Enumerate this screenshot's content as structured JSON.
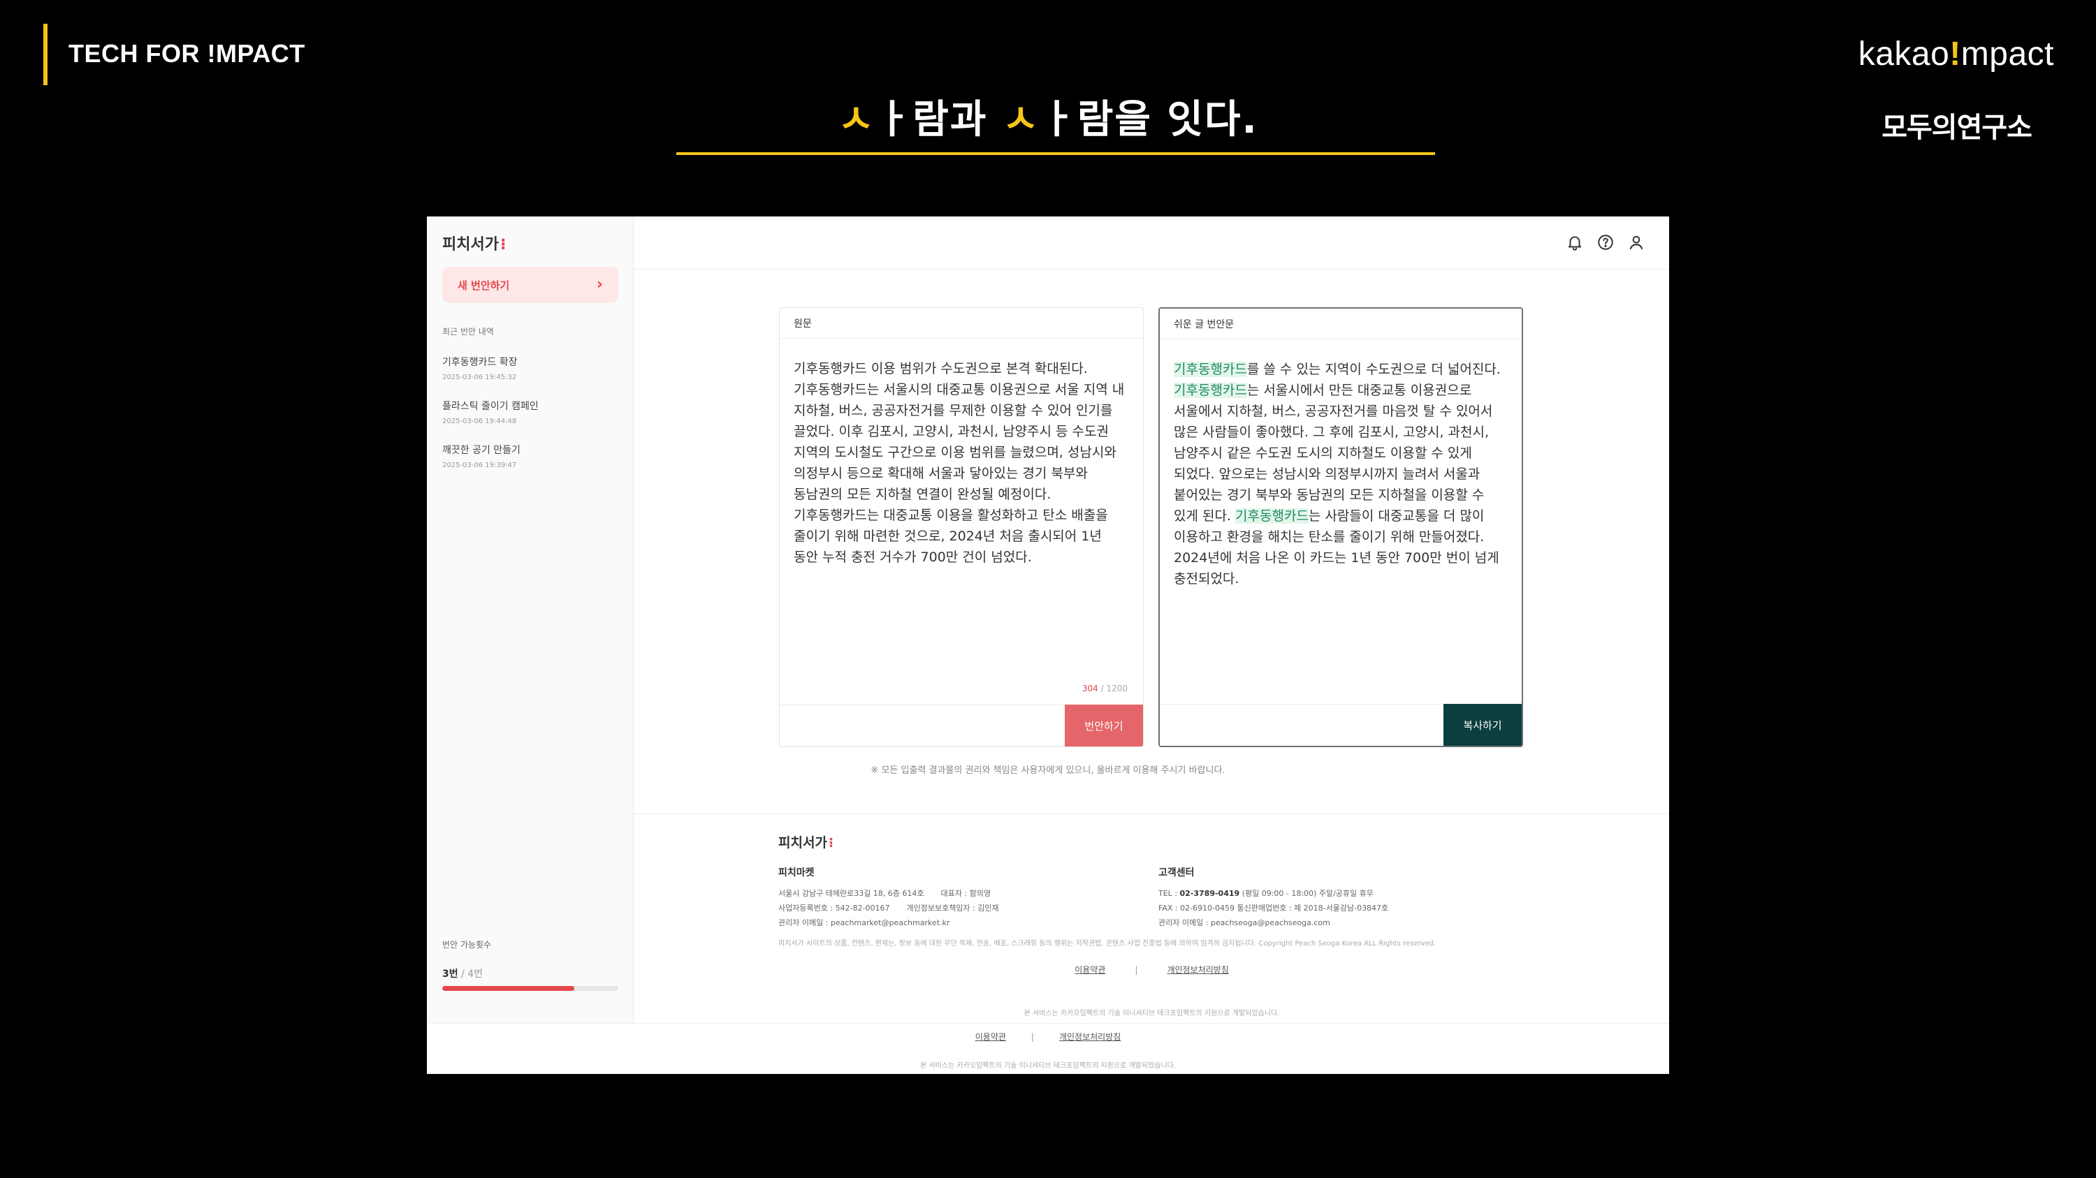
{
  "slide": {
    "brand": "TECH FOR !MPACT",
    "title": {
      "p1": "ㅅ",
      "p2": "ㅏ람과 ",
      "p3": "ㅅ",
      "p4": "ㅏ람을 잇다."
    },
    "kakao_logo": {
      "a": "kakao",
      "b": "!",
      "c": "mpact"
    },
    "lab_logo": "모두의연구소",
    "accent_color": "#f5c518"
  },
  "app": {
    "brand": "피치서가",
    "sidebar": {
      "new_button": "새 번안하기",
      "recent_header": "최근 번안 내역",
      "history": [
        {
          "title": "기후동행카드 확장",
          "time": "2025-03-06 19:45:32"
        },
        {
          "title": "플라스틱 줄이기 캠페인",
          "time": "2025-03-06 19:44:48"
        },
        {
          "title": "깨끗한 공기 만들기",
          "time": "2025-03-06 19:39:47"
        }
      ],
      "quota_label": "번안 가능횟수",
      "quota_used": "3번",
      "quota_total": " / 4번",
      "quota_fraction": 0.75
    },
    "topbar_icons": [
      "bell-icon",
      "help-icon",
      "user-icon"
    ],
    "source_panel": {
      "header": "원문",
      "text": "기후동행카드 이용 범위가 수도권으로 본격 확대된다. 기후동행카드는 서울시의 대중교통 이용권으로 서울 지역 내 지하철, 버스, 공공자전거를 무제한 이용할 수 있어 인기를 끌었다. 이후 김포시, 고양시, 과천시, 남양주시 등 수도권 지역의 도시철도 구간으로 이용 범위를 늘렸으며, 성남시와 의정부시 등으로 확대해 서울과 닿아있는 경기 북부와 동남권의 모든 지하철 연결이 완성될 예정이다. 기후동행카드는 대중교통 이용을 활성화하고 탄소 배출을 줄이기 위해 마련한 것으로, 2024년 처음 출시되어 1년 동안 누적 충전 거수가 700만 건이 넘었다.",
      "count_current": "304",
      "count_max": " / 1200",
      "button": "번안하기"
    },
    "easy_panel": {
      "header": "쉬운 글 번안문",
      "term": "기후동행카드",
      "seg1": "를 쓸 수 있는 지역이 수도권으로 더 넓어진다. ",
      "seg2": "는 서울시에서 만든 대중교통 이용권으로 서울에서 지하철, 버스, 공공자전거를 마음껏 탈 수 있어서 많은 사람들이 좋아했다. 그 후에 김포시, 고양시, 과천시, 남양주시 같은 수도권 도시의 지하철도 이용할 수 있게 되었다. 앞으로는 성남시와 의정부시까지 늘려서 서울과 붙어있는 경기 북부와 동남권의 모든 지하철을 이용할 수 있게 된다. ",
      "seg3": "는 사람들이 대중교통을 더 많이 이용하고 환경을 해치는 탄소를 줄이기 위해 만들어졌다. 2024년에 처음 나온 이 카드는 1년 동안 700만 번이 넘게 충전되었다.",
      "button": "복사하기",
      "highlight_color": "#1f8a63"
    },
    "disclaimer": "※ 모든 입출력 결과물의 권리와 책임은 사용자에게 있으니, 올바르게 이용해 주시기 바랍니다.",
    "footer": {
      "brand": "피치서가",
      "company": {
        "name": "피치마켓",
        "address": "서울시 강남구 테헤란로33길 18, 6층 614호",
        "ceo": "대표자 : 함의영",
        "biz_no": "사업자등록번호 : 542-82-00167",
        "privacy_officer": "개인정보보호책임자 : 김민재",
        "email": "관리자 이메일 : peachmarket@peachmarket.kr"
      },
      "support": {
        "name": "고객센터",
        "tel_label": "TEL : ",
        "tel": "02-3789-0419",
        "hours": " (평일 09:00 - 18:00)    주말/공휴일 휴무",
        "fax": "FAX : 02-6910-0459      통신판매업번호 : 제 2018-서울강남-03847호",
        "email": "관리자 이메일 : peachseoga@peachseoga.com"
      },
      "copyright": "피치서가 사이트의 상품, 컨텐츠, 편제는, 정보 등에 대한 무단 복제, 전송, 배포, 스크래핑 등의 행위는 저작권법, 콘텐츠 사업 진흥법 등에 의하여 엄격히 금지됩니다.  Copyright Peach Seoga Korea ALL Rights reserved.",
      "link_terms": "이용약관",
      "link_privacy": "개인정보처리방침",
      "service_note": "본 서비스는 카카오임팩트의 기술 이니셔티브 테크포임팩트의 지원으로 개발되었습니다."
    }
  }
}
